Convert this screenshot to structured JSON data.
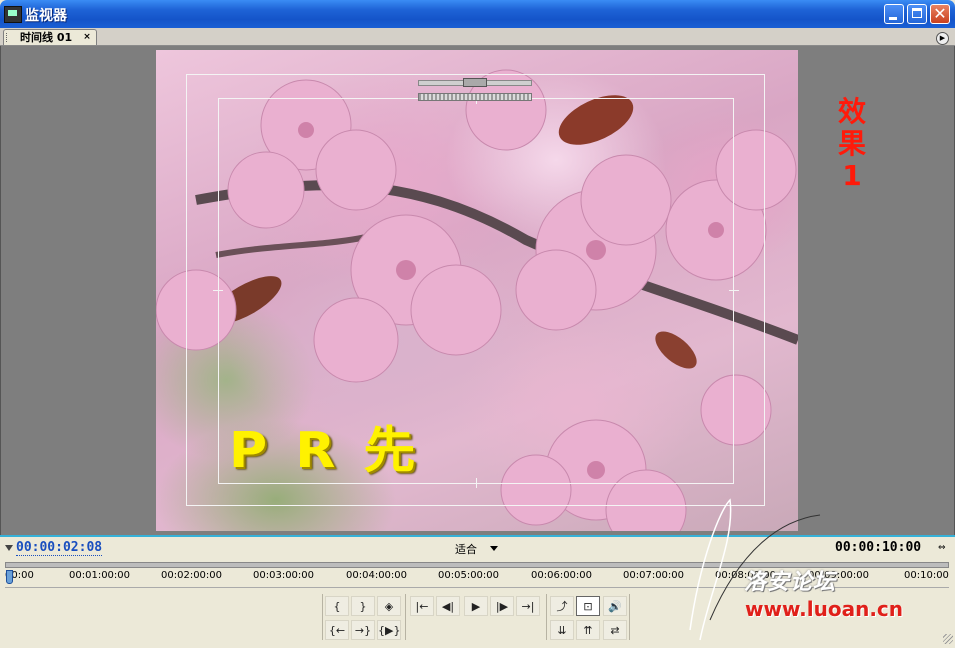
{
  "window": {
    "title": "监视器"
  },
  "tab": {
    "label": "时间线 01",
    "close": "×"
  },
  "monitor": {
    "overlay_title": "P R 先",
    "side_label": "效果1"
  },
  "controls": {
    "current_timecode": "00:00:02:08",
    "zoom": "适合",
    "duration_timecode": "00:00:10:00",
    "ruler_labels": [
      "00:00",
      "00:01:00:00",
      "00:02:00:00",
      "00:03:00:00",
      "00:04:00:00",
      "00:05:00:00",
      "00:06:00:00",
      "00:07:00:00",
      "00:08:00:00",
      "00:09:00:00",
      "00:10:00"
    ],
    "buttons_row1": [
      "{",
      "}",
      "◈",
      "|←",
      "◀|",
      "▶",
      "|▶",
      "→|",
      "⤴",
      "⊡",
      "🔊"
    ],
    "buttons_row2": [
      "{←",
      "→}",
      "{▶}",
      "⇊",
      "⇈",
      "⇄"
    ]
  },
  "watermark": {
    "cn_text": "洛安论坛",
    "url": "www.luoan.cn"
  },
  "colors": {
    "titlebar": "#1e63d6",
    "accent_line": "#35b1d8",
    "timecode": "#1a4fbf",
    "title_yellow": "#fff200",
    "side_label_red": "#ff1a0a"
  }
}
